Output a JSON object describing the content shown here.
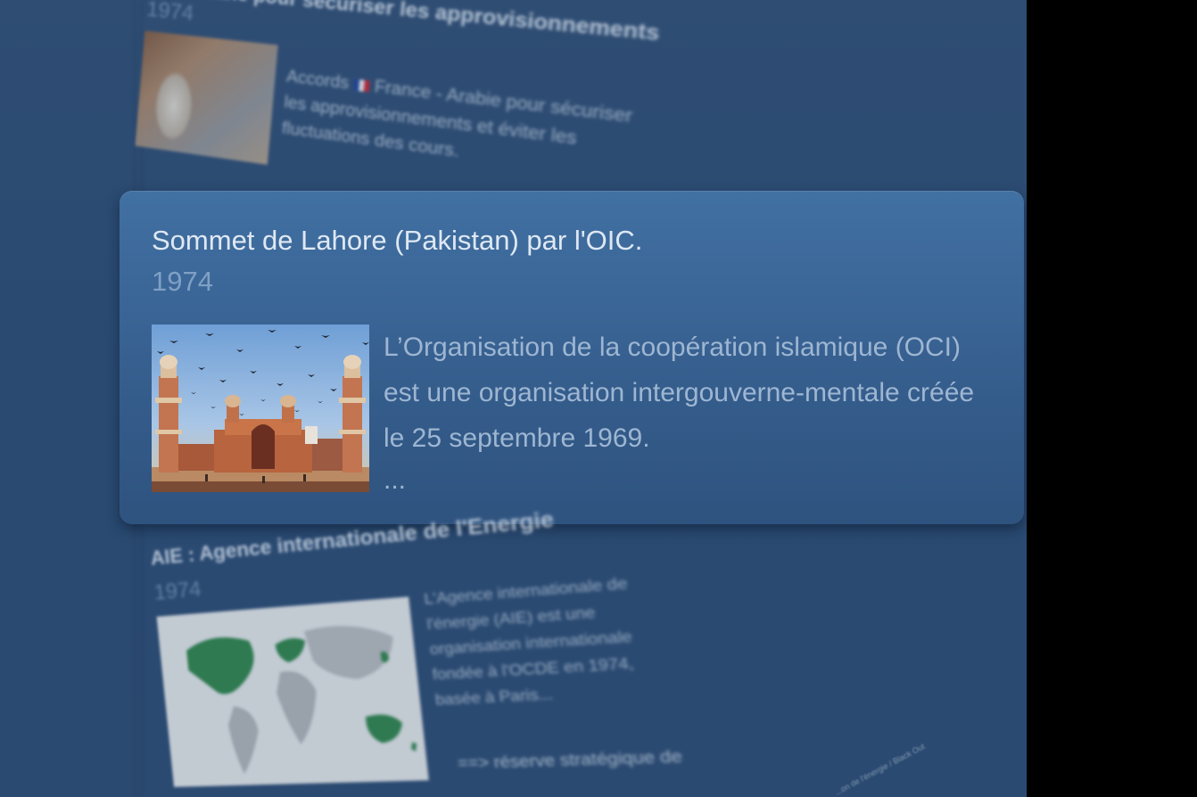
{
  "entries": {
    "previous": {
      "title_fragment": "...abie pour sécuriser les approvisionnements",
      "year": "1974",
      "summary_prefix": "Accords",
      "summary_rest": "France - Arabie pour sécuriser les approvisionnements et éviter les fluctuations des cours."
    },
    "focused": {
      "title": "Sommet de Lahore (Pakistan) par l'OIC.",
      "year": "1974",
      "summary": "L’Organisation de la coopération islamique (OCI) est une organisation intergouverne-mentale créée le 25 septembre 1969.",
      "ellipsis": "..."
    },
    "next": {
      "title": "AIE : Agence internationale de l'Energie",
      "year": "1974",
      "summary": "L'Agence internationale de l'énergie (AIE) est une organisation internationale fondée à l'OCDE en 1974, basée à Paris...",
      "more": "==> réserve stratégique de",
      "credit": "...on de l'énergie / Black Out"
    }
  },
  "icons": {
    "france_flag": "flag-france-icon"
  },
  "colors": {
    "background": "#2b4a71",
    "card": "#3a6596",
    "title_text": "#dfe8f3",
    "year_text": "#7fa0c4",
    "body_text": "#9eb6d2",
    "map_highlight": "#2f8a45"
  }
}
